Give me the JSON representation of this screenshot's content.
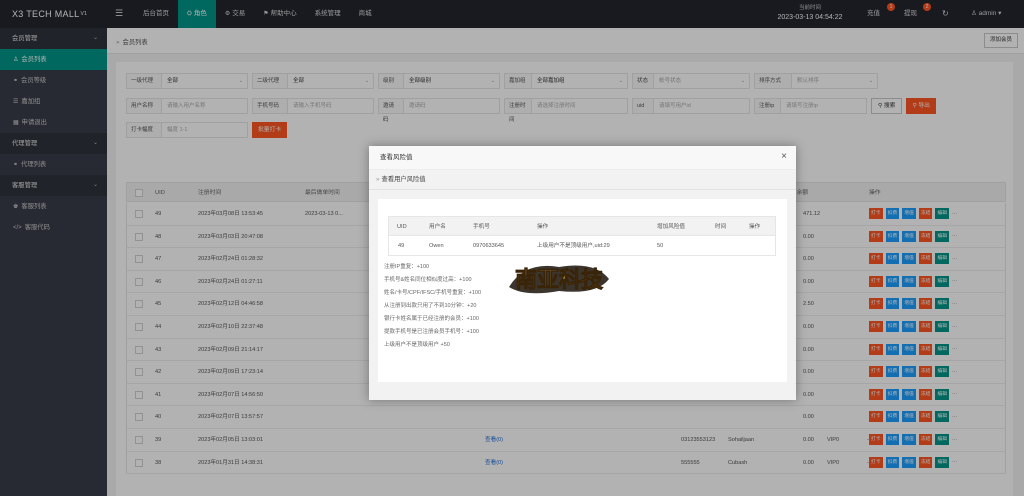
{
  "app": {
    "logo": "X3 TECH MALL",
    "logo_version": "V1"
  },
  "topnav": [
    {
      "label": "后台首页",
      "icon": "none"
    },
    {
      "label": "角色",
      "icon": "user-icon"
    },
    {
      "label": "交易",
      "icon": "gear-icon"
    },
    {
      "label": "帮助中心",
      "icon": "flag-icon"
    },
    {
      "label": "系统管理",
      "icon": "none"
    },
    {
      "label": "商城",
      "icon": "none"
    }
  ],
  "clock": {
    "label": "当前时间",
    "value": "2023-03-13 04:54:22"
  },
  "topbar_right": {
    "recharge": "充值",
    "recharge_badge": "1",
    "withdraw": "提现",
    "withdraw_badge": "2",
    "refresh_icon": "refresh-icon",
    "user": "admin"
  },
  "sidebar": {
    "groups": [
      {
        "label": "会员管理",
        "items": [
          {
            "label": "会员列表",
            "icon": "user-icon",
            "active": true
          },
          {
            "label": "会员等级",
            "icon": "link-icon"
          },
          {
            "label": "嘉加组",
            "icon": "list-icon"
          },
          {
            "label": "申请退出",
            "icon": "table-icon"
          }
        ]
      },
      {
        "label": "代理管理",
        "items": [
          {
            "label": "代理列表",
            "icon": "link-icon"
          }
        ]
      },
      {
        "label": "客服管理",
        "items": [
          {
            "label": "客服列表",
            "icon": "users-icon"
          },
          {
            "label": "客服代码",
            "icon": "code-icon"
          }
        ]
      }
    ]
  },
  "breadcrumb": {
    "current": "会员列表"
  },
  "add_member_label": "添加会员",
  "filters": {
    "row1": [
      {
        "label": "一级代理",
        "value": "全部",
        "dropdown": true
      },
      {
        "label": "二级代理",
        "value": "全部",
        "dropdown": true
      },
      {
        "label": "级别",
        "value": "全部级别",
        "dropdown": true
      },
      {
        "label": "嘉加组",
        "value": "全部嘉加组",
        "dropdown": true
      },
      {
        "label": "状态",
        "value": "帐号状态",
        "dropdown": true,
        "placeholder": true
      },
      {
        "label": "排序方式",
        "value": "默认排序",
        "dropdown": true,
        "placeholder": true
      }
    ],
    "row2": [
      {
        "label": "用户名称",
        "value": "请输入用户名称",
        "placeholder": true
      },
      {
        "label": "手机号码",
        "value": "请输入手机号码",
        "placeholder": true
      },
      {
        "label": "邀请码",
        "value": "邀请码",
        "placeholder": true
      },
      {
        "label": "注册时间",
        "value": "请选择注册时间",
        "placeholder": true
      },
      {
        "label": "uid",
        "value": "请填写用户id",
        "placeholder": true
      },
      {
        "label": "注册ip",
        "value": "请填写注册ip",
        "placeholder": true
      }
    ],
    "search_label": "搜索",
    "export_label": "导出",
    "row3": {
      "label": "打卡幅度",
      "value": "幅度 1-1",
      "button": "批量打卡"
    }
  },
  "table": {
    "headers": {
      "uid": "UID",
      "reg_time": "注册时间",
      "last_time": "最后做单时间",
      "balance": "用户余额",
      "actions": "操作"
    },
    "rows": [
      {
        "uid": "49",
        "reg_time": "2023年03月08日 13:53:45",
        "last_time": "2023-03-13 0...",
        "balance": "471.12"
      },
      {
        "uid": "48",
        "reg_time": "2023年03月03日 20:47:08",
        "last_time": "",
        "balance": "0.00"
      },
      {
        "uid": "47",
        "reg_time": "2023年02月24日 01:28:32",
        "last_time": "",
        "balance": "0.00"
      },
      {
        "uid": "46",
        "reg_time": "2023年02月24日 01:27:11",
        "last_time": "",
        "balance": "0.00"
      },
      {
        "uid": "45",
        "reg_time": "2023年02月12日 04:46:58",
        "last_time": "",
        "balance": "2.50"
      },
      {
        "uid": "44",
        "reg_time": "2023年02月10日 22:37:48",
        "last_time": "",
        "balance": "0.00"
      },
      {
        "uid": "43",
        "reg_time": "2023年02月09日 21:14:17",
        "last_time": "",
        "balance": "0.00"
      },
      {
        "uid": "42",
        "reg_time": "2023年02月09日 17:23:14",
        "last_time": "",
        "balance": "0.00"
      },
      {
        "uid": "41",
        "reg_time": "2023年02月07日 14:56:50",
        "last_time": "",
        "balance": "0.00"
      },
      {
        "uid": "40",
        "reg_time": "2023年02月07日 13:57:57",
        "last_time": "",
        "balance": "0.00"
      },
      {
        "uid": "39",
        "reg_time": "2023年02月05日 13:03:01",
        "last_time": "",
        "invite": "查看(0)",
        "phone": "03123553123",
        "username": "Sohailjaan",
        "vip": "VIP0",
        "dash": "--",
        "balance": "0.00"
      },
      {
        "uid": "38",
        "reg_time": "2023年01月31日 14:38:31",
        "last_time": "",
        "invite": "查看(0)",
        "phone": "555555",
        "username": "Cubash",
        "vip": "VIP0",
        "dash": "--",
        "balance": "0.00"
      }
    ],
    "action_labels": {
      "clock": "打卡",
      "upgrade": "扣费",
      "deposit": "增值",
      "deduct": "冻结",
      "edit": "编辑",
      "more": "···"
    }
  },
  "modal": {
    "title": "查看风险值",
    "close_icon": "close-icon",
    "subtitle": "查看用户风险值",
    "table": {
      "headers": [
        "UID",
        "用户名",
        "手机号",
        "操作",
        "增加风险值",
        "时间",
        "操作"
      ],
      "row": [
        "49",
        "Owen",
        "0970633645",
        "上级用户不是顶级用户,uid:29",
        "50",
        "",
        ""
      ]
    },
    "rules": [
      "注册IP重复：+100",
      "手机号&姓名同位相似度过高：+100",
      "姓名/卡号/CPF/IFSC/手机号重复：+100",
      "从注册到出款只用了不到10分钟：+20",
      "银行卡姓名属于已经注册的会员：+100",
      "提款手机号是已注册会员手机号：+100",
      "上级用户不是顶级用户 +50"
    ]
  },
  "watermark": {
    "text": "南亚科技",
    "name": "brand-watermark-logo"
  }
}
